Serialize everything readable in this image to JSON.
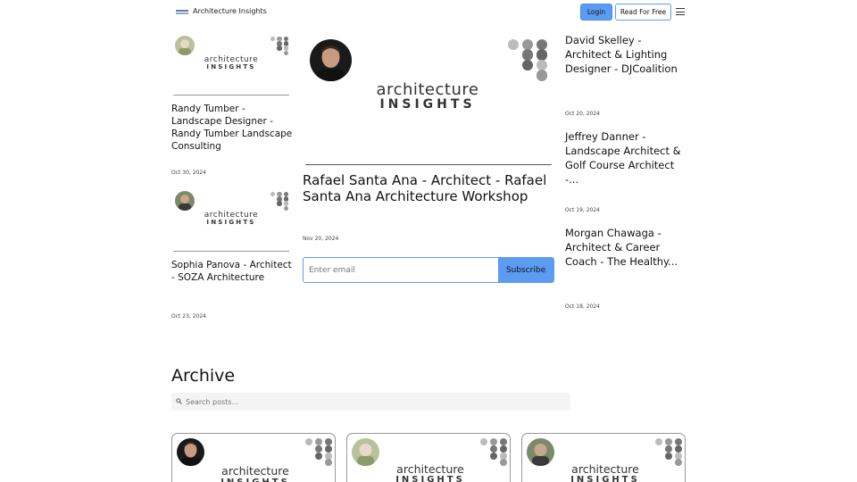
{
  "header": {
    "site_title": "Architecture Insights",
    "login_label": "Login",
    "read_label": "Read For Free",
    "menu_icon": "hamburger-menu-icon"
  },
  "brand": {
    "wordmark_top": "architecture",
    "wordmark_bottom": "INSIGHTS",
    "accent": "#5b9cf2"
  },
  "left_posts": [
    {
      "title": "Randy Tumber - Landscape Designer - Randy Tumber Landscape Consulting",
      "date": "Oct 30, 2024"
    },
    {
      "title": "Sophia Panova - Architect - SOZA Architecture",
      "date": "Oct 23, 2024"
    }
  ],
  "featured": {
    "title": "Rafael Santa Ana - Architect - Rafael Santa Ana Architecture Workshop",
    "date": "Nov 20, 2024"
  },
  "right_posts": [
    {
      "title": "David Skelley - Architect & Lighting Designer - DJCoalition",
      "date": "Oct 20, 2024"
    },
    {
      "title": "Jeffrey Danner - Landscape Architect & Golf Course Architect -...",
      "date": "Oct 19, 2024"
    },
    {
      "title": "Morgan Chawaga - Architect & Career Coach - The Healthy...",
      "date": "Oct 18, 2024"
    }
  ],
  "subscribe": {
    "placeholder": "Enter email",
    "button_label": "Subscribe"
  },
  "archive": {
    "heading": "Archive",
    "search_placeholder": "Search posts..."
  }
}
